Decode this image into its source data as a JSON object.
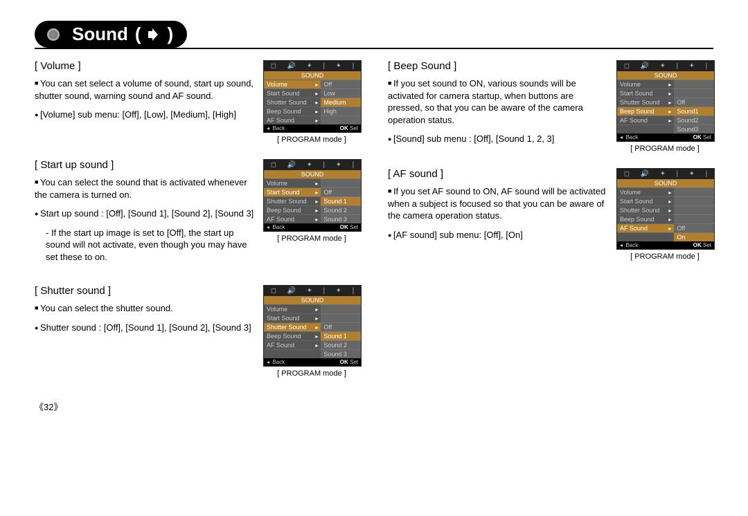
{
  "page_number": "《32》",
  "title": "Sound",
  "sections": {
    "volume": {
      "heading": "[ Volume ]",
      "para1": "You can set select a volume of sound, start up sound, shutter sound, warning sound and AF sound.",
      "para2": "[Volume] sub menu: [Off], [Low], [Medium], [High]",
      "caption": "[ PROGRAM mode ]",
      "menu": {
        "header": "SOUND",
        "rows": [
          {
            "left": "Volume",
            "right": "Off",
            "selLeft": true
          },
          {
            "left": "Start Sound",
            "right": "Low"
          },
          {
            "left": "Shutter Sound",
            "right": "Medium",
            "selRight": true
          },
          {
            "left": "Beep Sound",
            "right": "High"
          },
          {
            "left": "AF Sound",
            "right": ""
          }
        ],
        "back": "Back",
        "ok": "OK",
        "set": "Set"
      }
    },
    "startup": {
      "heading": "[ Start up sound ]",
      "para1": "You can select the sound that is activated whenever the camera is turned on.",
      "para2": "Start up sound : [Off], [Sound 1], [Sound 2], [Sound 3]",
      "para2_indent": "[Sound 3]",
      "note": "- If the start up image is set to [Off], the start up sound will not activate, even though you may have set these to on.",
      "caption": "[ PROGRAM mode ]",
      "menu": {
        "header": "SOUND",
        "rows": [
          {
            "left": "Volume",
            "right": ""
          },
          {
            "left": "Start Sound",
            "right": "Off",
            "selLeft": true
          },
          {
            "left": "Shutter Sound",
            "right": "Sound 1",
            "selRight": true
          },
          {
            "left": "Beep Sound",
            "right": "Sound 2"
          },
          {
            "left": "AF Sound",
            "right": "Sound 3"
          }
        ],
        "back": "Back",
        "ok": "OK",
        "set": "Set"
      }
    },
    "shutter": {
      "heading": "[ Shutter sound ]",
      "para1": "You can select the shutter sound.",
      "para2": "Shutter sound : [Off], [Sound 1], [Sound 2], [Sound 3]",
      "para2_indent": "[Sound 3]",
      "caption": "[ PROGRAM mode ]",
      "menu": {
        "header": "SOUND",
        "rows": [
          {
            "left": "Volume",
            "right": ""
          },
          {
            "left": "Start Sound",
            "right": ""
          },
          {
            "left": "Shutter Sound",
            "right": "Off",
            "selLeft": true
          },
          {
            "left": "Beep Sound",
            "right": "Sound 1",
            "selRight": true
          },
          {
            "left": "AF Sound",
            "right": "Sound 2"
          },
          {
            "left": "",
            "right": "Sound 3"
          }
        ],
        "back": "Back",
        "ok": "OK",
        "set": "Set"
      }
    },
    "beep": {
      "heading": "[ Beep Sound ]",
      "para1": "If you set sound to ON, various sounds will be activated for camera startup, when buttons are pressed, so that you can be aware of the camera operation status.",
      "para2": "[Sound] sub menu : [Off], [Sound 1, 2, 3]",
      "caption": "[ PROGRAM mode ]",
      "menu": {
        "header": "SOUND",
        "rows": [
          {
            "left": "Volume",
            "right": ""
          },
          {
            "left": "Start Sound",
            "right": ""
          },
          {
            "left": "Shutter Sound",
            "right": "Off"
          },
          {
            "left": "Beep Sound",
            "right": "Sound1",
            "selLeft": true,
            "selRight": true
          },
          {
            "left": "AF Sound",
            "right": "Sound2"
          },
          {
            "left": "",
            "right": "Sound3"
          }
        ],
        "back": "Back",
        "ok": "OK",
        "set": "Set"
      }
    },
    "af": {
      "heading": "[ AF sound ]",
      "para1": "If you set AF sound to ON, AF sound will be activated when a subject is focused so that you can be aware of the camera operation status.",
      "para2": "[AF sound] sub menu: [Off], [On]",
      "caption": "[ PROGRAM mode ]",
      "menu": {
        "header": "SOUND",
        "rows": [
          {
            "left": "Volume",
            "right": ""
          },
          {
            "left": "Start Sound",
            "right": ""
          },
          {
            "left": "Shutter Sound",
            "right": ""
          },
          {
            "left": "Beep Sound",
            "right": ""
          },
          {
            "left": "AF Sound",
            "right": "Off",
            "selLeft": true
          },
          {
            "left": "",
            "right": "On",
            "selRight": true
          }
        ],
        "back": "Back",
        "ok": "OK",
        "set": "Set"
      }
    }
  }
}
